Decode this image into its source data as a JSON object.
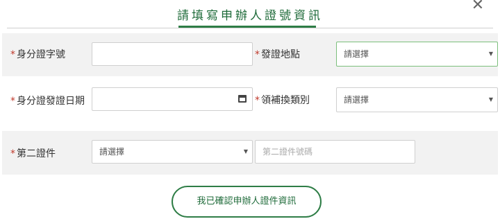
{
  "dialog": {
    "title": "請填寫申辦人證號資訊",
    "close_glyph": "✕"
  },
  "form": {
    "id_number": {
      "label": "身分證字號",
      "required_mark": "*",
      "value": ""
    },
    "issue_place": {
      "label": "發證地點",
      "required_mark": "*",
      "selected": "請選擇"
    },
    "issue_date": {
      "label": "身分證發證日期",
      "required_mark": "*",
      "value": ""
    },
    "issue_type": {
      "label": "領補換類別",
      "required_mark": "*",
      "selected": "請選擇"
    },
    "second_id": {
      "label": "第二證件",
      "required_mark": "*",
      "selected": "請選擇"
    },
    "second_id_number": {
      "placeholder": "第二證件號碼",
      "value": ""
    }
  },
  "actions": {
    "confirm_label": "我已確認申辦人證件資訊"
  },
  "icons": {
    "dropdown": "caret-down-icon",
    "calendar": "calendar-icon",
    "close": "close-icon"
  },
  "colors": {
    "accent": "#2e7d46",
    "required": "#c0392b",
    "row_bg": "#f2f2f2"
  }
}
